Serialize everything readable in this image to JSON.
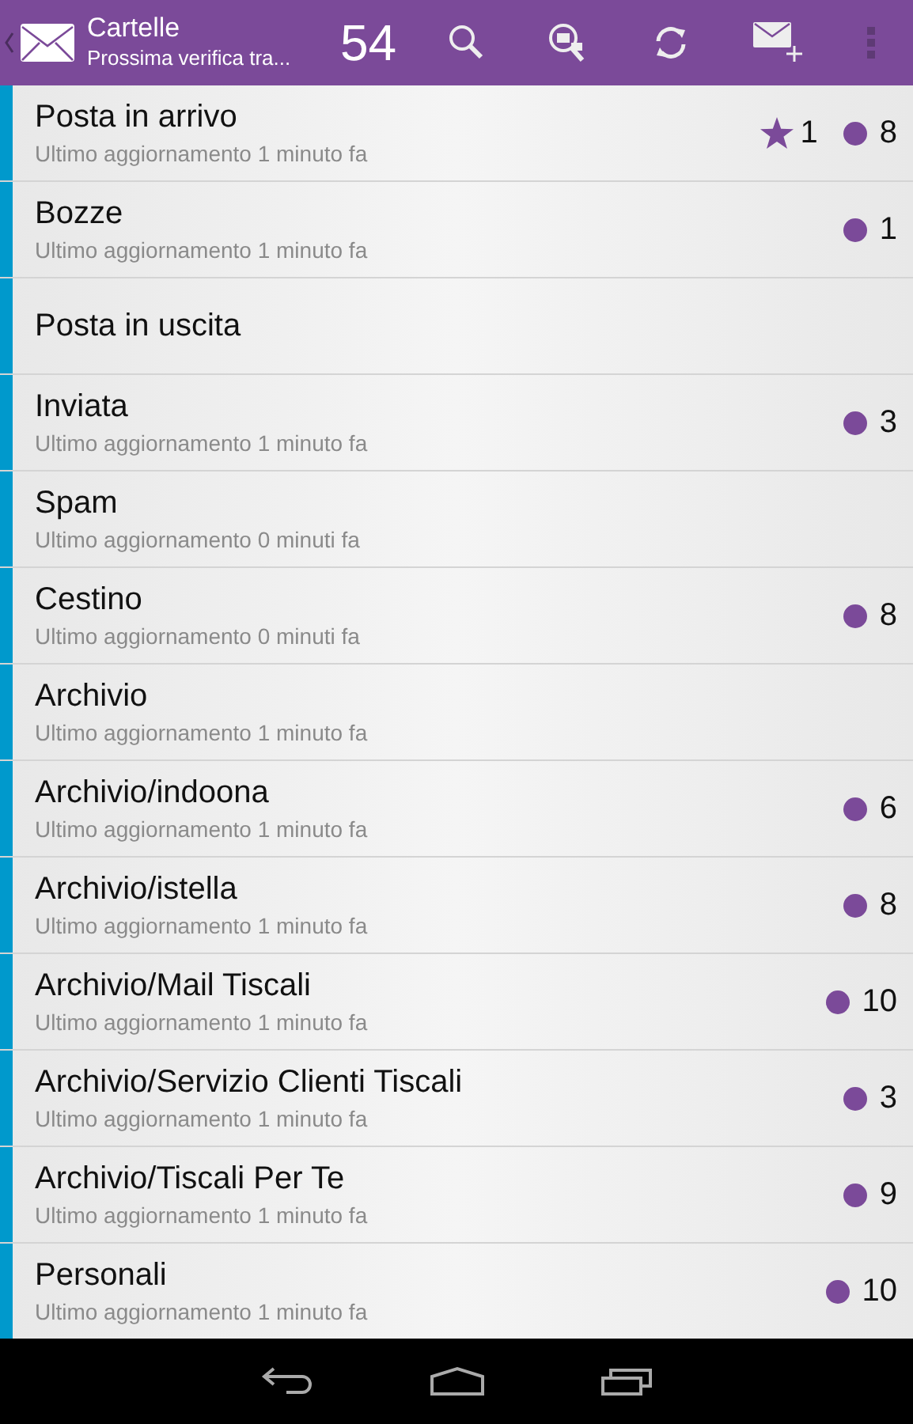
{
  "action_bar": {
    "title": "Cartelle",
    "subtitle": "Prossima verifica tra...",
    "count": "54"
  },
  "folders": [
    {
      "name": "Posta in arrivo",
      "updated": "Ultimo aggiornamento 1 minuto fa",
      "starred": "1",
      "unread": "8"
    },
    {
      "name": "Bozze",
      "updated": "Ultimo aggiornamento 1 minuto fa",
      "unread": "1"
    },
    {
      "name": "Posta in uscita"
    },
    {
      "name": "Inviata",
      "updated": "Ultimo aggiornamento 1 minuto fa",
      "unread": "3"
    },
    {
      "name": "Spam",
      "updated": "Ultimo aggiornamento 0 minuti fa"
    },
    {
      "name": "Cestino",
      "updated": "Ultimo aggiornamento 0 minuti fa",
      "unread": "8"
    },
    {
      "name": "Archivio",
      "updated": "Ultimo aggiornamento 1 minuto fa"
    },
    {
      "name": "Archivio/indoona",
      "updated": "Ultimo aggiornamento 1 minuto fa",
      "unread": "6"
    },
    {
      "name": "Archivio/istella",
      "updated": "Ultimo aggiornamento 1 minuto fa",
      "unread": "8"
    },
    {
      "name": "Archivio/Mail Tiscali",
      "updated": "Ultimo aggiornamento 1 minuto fa",
      "unread": "10"
    },
    {
      "name": "Archivio/Servizio Clienti Tiscali",
      "updated": "Ultimo aggiornamento 1 minuto fa",
      "unread": "3"
    },
    {
      "name": "Archivio/Tiscali Per Te",
      "updated": "Ultimo aggiornamento 1 minuto fa",
      "unread": "9"
    },
    {
      "name": "Personali",
      "updated": "Ultimo aggiornamento 1 minuto fa",
      "unread": "10"
    }
  ]
}
